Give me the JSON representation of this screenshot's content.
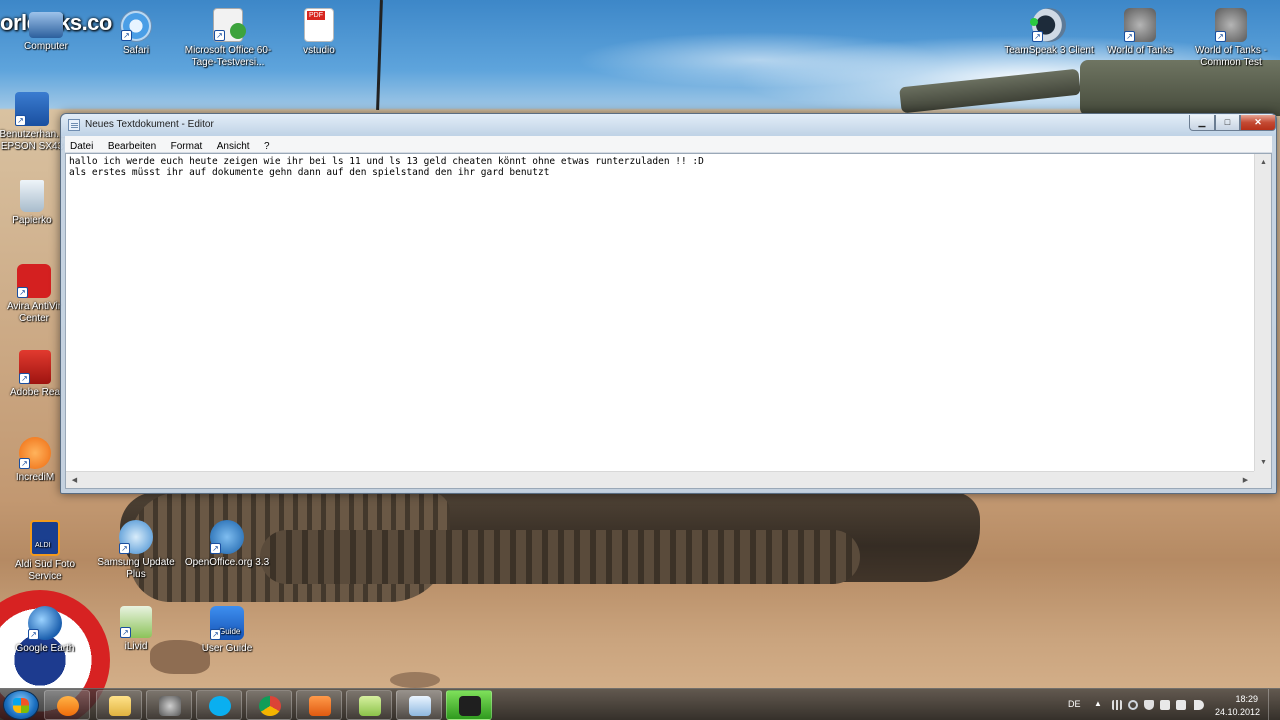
{
  "desktop": {
    "logo_text": "orld   nks.co",
    "icons_top": [
      {
        "label": "Computer"
      },
      {
        "label": "Safari"
      },
      {
        "label": "Microsoft Office 60-Tage-Testversi..."
      },
      {
        "label": "vstudio"
      },
      {
        "label": "TeamSpeak 3 Client"
      },
      {
        "label": "World of Tanks"
      },
      {
        "label": "World of Tanks - Common Test"
      }
    ],
    "icons_left": [
      {
        "label": "Benutzerhan... EPSON SX43"
      },
      {
        "label": "Papierko"
      },
      {
        "label": "Avira AntiVir Center"
      },
      {
        "label": "Adobe Rea"
      },
      {
        "label": "IncrediM"
      }
    ],
    "icons_bottom": [
      {
        "label": "Aldi Süd Foto Service"
      },
      {
        "label": "Samsung Update Plus"
      },
      {
        "label": "OpenOffice.org 3.3"
      },
      {
        "label": "Google Earth"
      },
      {
        "label": "iLivid"
      },
      {
        "label": "User Guide"
      }
    ],
    "pdf_badge": "PDF",
    "aldi_badge": "ALDI",
    "guide_badge": "Guide"
  },
  "editor": {
    "title": "Neues Textdokument - Editor",
    "minimize": "▁",
    "maximize": "□",
    "close": "✕",
    "menu": [
      {
        "label": "Datei"
      },
      {
        "label": "Bearbeiten"
      },
      {
        "label": "Format"
      },
      {
        "label": "Ansicht"
      },
      {
        "label": "?"
      }
    ],
    "lines": [
      "hallo ich werde euch heute zeigen wie ihr bei ls 11 und ls 13 geld cheaten könnt ohne etwas runterzuladen !! :D",
      "als erstes müsst ihr auf dokumente gehn dann auf den spielstand den ihr gard benutzt"
    ]
  },
  "taskbar": {
    "language": "DE",
    "time": "18:29",
    "date": "24.10.2012"
  },
  "colors": {
    "sky": "#5ea4dc",
    "sand": "#c29871",
    "close_red": "#c44a33",
    "window_glass": "#c4d6e8"
  }
}
